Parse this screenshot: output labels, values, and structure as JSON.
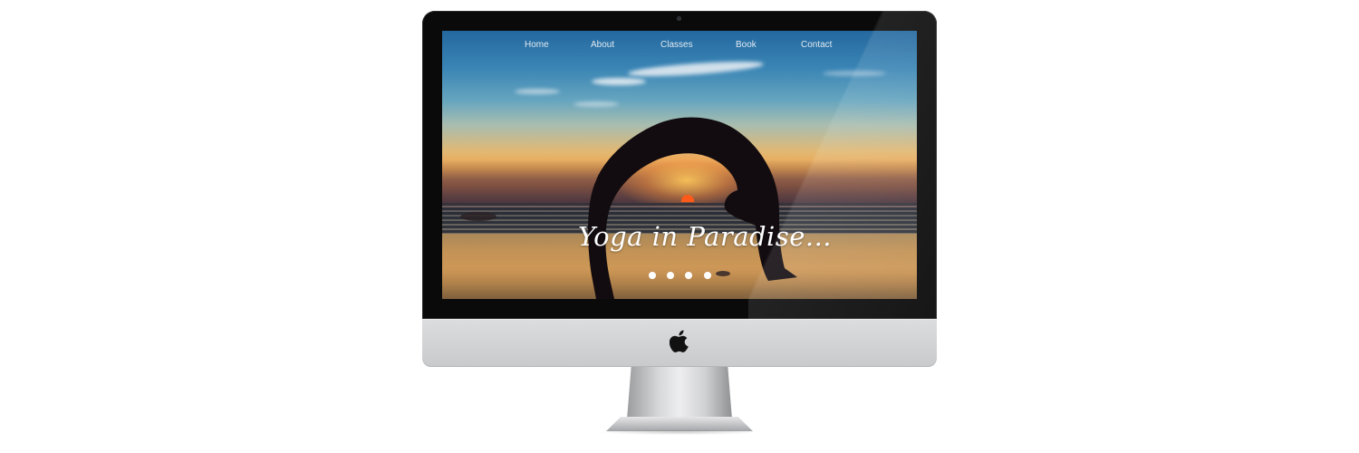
{
  "nav": {
    "items": [
      {
        "label": "Home"
      },
      {
        "label": "About"
      },
      {
        "label": "Classes"
      },
      {
        "label": "Book"
      },
      {
        "label": "Contact"
      }
    ]
  },
  "hero": {
    "title": "Yoga in Paradise...",
    "slide_count": 4
  },
  "device": {
    "logo_icon": "apple-logo-icon",
    "frame_color": "#0a0a0a",
    "chin_color": "#d0d1d3"
  }
}
